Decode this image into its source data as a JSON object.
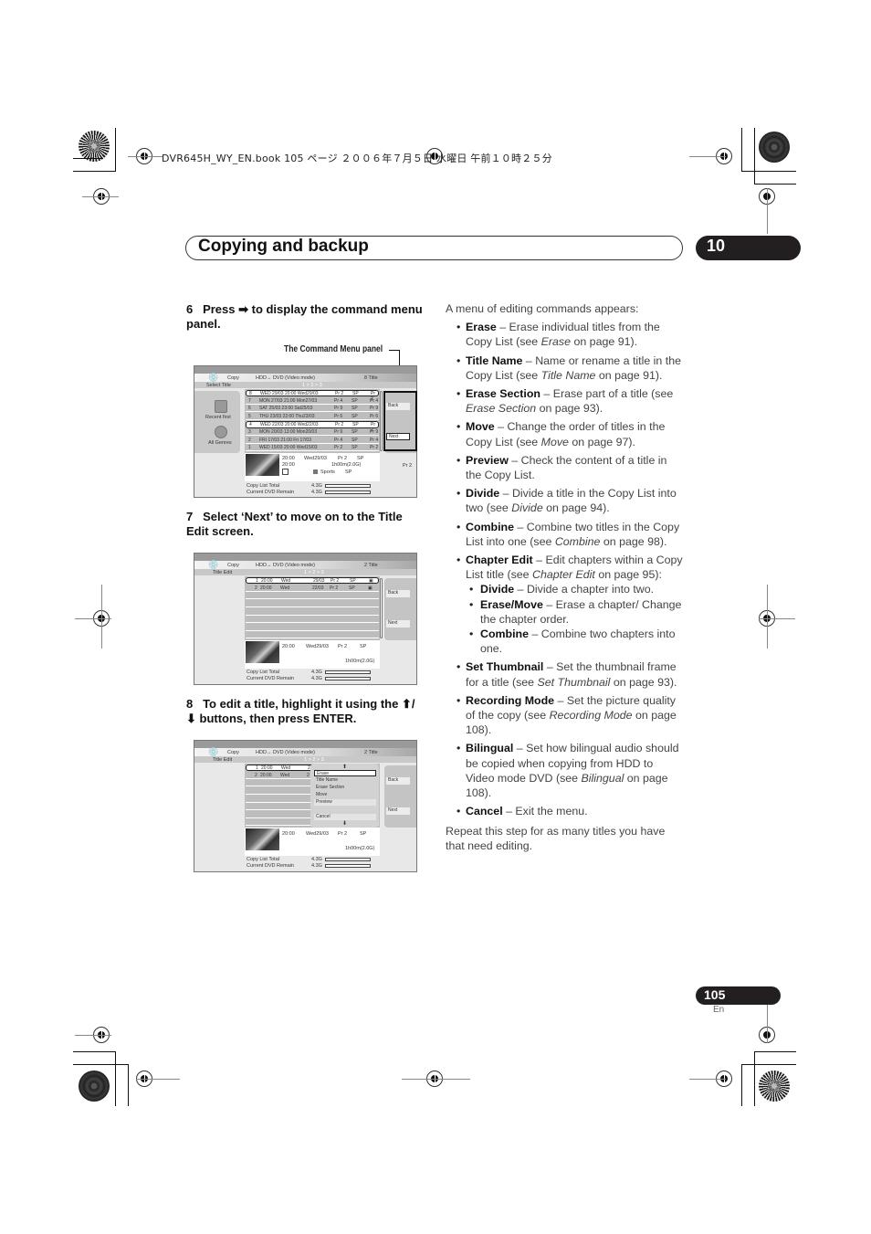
{
  "print_header": "DVR645H_WY_EN.book  105 ページ  ２００６年７月５日  水曜日  午前１０時２５分",
  "chapter": {
    "title": "Copying and backup",
    "number": "10"
  },
  "steps": [
    {
      "num": "6",
      "text": "Press ➡ to display the command menu panel."
    },
    {
      "num": "7",
      "text": "Select ‘Next’ to move on to the Title Edit screen."
    },
    {
      "num": "8",
      "text": "To edit a title, highlight it using the ⬆/⬇ buttons, then press ENTER."
    }
  ],
  "callout": "The Command Menu panel",
  "screen1": {
    "mode": "Copy",
    "route": "HDD→ DVD (Video mode)",
    "count": "8  Title",
    "section": "Select Title",
    "pager": "1 > 2 > 3",
    "left_options": [
      "Recent first",
      "All Genres"
    ],
    "rows": [
      [
        "8",
        "WED 29/03 20:00 Wed29/03",
        "Pr 2",
        "SP",
        "Pr 2"
      ],
      [
        "7",
        "MON 27/03 21:00 Mon27/03",
        "Pr 4",
        "SP",
        "Pr 4"
      ],
      [
        "6",
        "SAT 25/03 23:00 Sat25/03",
        "Pr 9",
        "SP",
        "Pr 9"
      ],
      [
        "5",
        "THU 23/03 22:00 Thu23/03",
        "Pr 6",
        "SP",
        "Pr 6"
      ],
      [
        "4",
        "WED 22/03 20:00 Wed22/03",
        "Pr 2",
        "SP",
        "Pr 2"
      ],
      [
        "3",
        "MON 20/03 13:00 Mon20/03",
        "Pr 9",
        "SP",
        "Pr 9"
      ],
      [
        "2",
        "FRI 17/03 21:00 Fri 17/03",
        "Pr 4",
        "SP",
        "Pr 4"
      ],
      [
        "1",
        "WED 15/03 20:00 Wed15/03",
        "Pr 2",
        "SP",
        "Pr 2"
      ]
    ],
    "buttons": [
      "Back",
      "Next"
    ],
    "preview": {
      "time1": "20:00",
      "time2": "20:00",
      "date": "Wed29/03",
      "ch": "Pr 2",
      "mode": "SP",
      "duration": "1h00m(2.0G)",
      "genre": "Sports",
      "genre_mode": "SP",
      "side": "Pr 2"
    },
    "totals": [
      {
        "label": "Copy List Total",
        "value": "4.3G"
      },
      {
        "label": "Current DVD Remain",
        "value": "4.3G"
      }
    ]
  },
  "screen2": {
    "mode": "Copy",
    "route": "HDD→ DVD (Video mode)",
    "count": "2  Title",
    "section": "Title Edit",
    "pager": "1 > 2 > 3",
    "rows": [
      [
        "1",
        "20:00",
        "Wed",
        "29/03",
        "Pr 2",
        "SP"
      ],
      [
        "2",
        "20:00",
        "Wed",
        "22/03",
        "Pr 2",
        "SP"
      ]
    ],
    "buttons": [
      "Back",
      "Next"
    ],
    "preview": {
      "time": "20:00",
      "date": "Wed29/03",
      "ch": "Pr 2",
      "mode": "SP",
      "duration": "1h00m(2.0G)"
    },
    "totals": [
      {
        "label": "Copy List Total",
        "value": "4.3G"
      },
      {
        "label": "Current DVD Remain",
        "value": "4.3G"
      }
    ]
  },
  "screen3": {
    "popup_items": [
      "Erase",
      "Title Name",
      "Erase Section",
      "Move",
      "Preview",
      "Cancel"
    ]
  },
  "right_column": {
    "intro": "A menu of editing commands appears:",
    "items": [
      {
        "term": "Erase",
        "desc": " – Erase individual titles from the Copy List (see ",
        "ref": "Erase",
        "tail": " on page 91)."
      },
      {
        "term": "Title Name",
        "desc": " – Name or rename a title in the Copy List (see ",
        "ref": "Title Name",
        "tail": " on page 91)."
      },
      {
        "term": "Erase Section",
        "desc": " – Erase part of a title (see ",
        "ref": "Erase Section",
        "tail": " on page 93)."
      },
      {
        "term": "Move",
        "desc": " – Change the order of titles in the Copy List (see ",
        "ref": "Move",
        "tail": " on page 97)."
      },
      {
        "term": "Preview",
        "desc": " – Check the content of a title in the Copy List.",
        "ref": "",
        "tail": ""
      },
      {
        "term": "Divide",
        "desc": " – Divide a title in the Copy List into two (see ",
        "ref": "Divide",
        "tail": " on page 94)."
      },
      {
        "term": "Combine",
        "desc": " – Combine two titles in the Copy List into one (see ",
        "ref": "Combine",
        "tail": " on page 98)."
      },
      {
        "term": "Chapter Edit",
        "desc": " – Edit chapters within a Copy List title (see ",
        "ref": "Chapter Edit",
        "tail": " on page 95):"
      }
    ],
    "chapter_sub": [
      {
        "term": "Divide",
        "desc": " – Divide a chapter into two."
      },
      {
        "term": "Erase/Move",
        "desc": " – Erase a chapter/ Change the chapter order."
      },
      {
        "term": "Combine",
        "desc": " – Combine two chapters into one."
      }
    ],
    "items2": [
      {
        "term": "Set Thumbnail",
        "desc": " – Set the thumbnail frame for a title (see ",
        "ref": "Set Thumbnail",
        "tail": " on page 93)."
      },
      {
        "term": "Recording Mode",
        "desc": " – Set the picture quality of the copy (see ",
        "ref": "Recording Mode",
        "tail": " on page 108)."
      },
      {
        "term": "Bilingual",
        "desc": " – Set how bilingual audio should be copied when copying from HDD to Video mode DVD (see ",
        "ref": "Bilingual",
        "tail": " on page 108)."
      },
      {
        "term": "Cancel",
        "desc": " – Exit the menu.",
        "ref": "",
        "tail": ""
      }
    ],
    "outro": "Repeat this step for as many titles you have that need editing."
  },
  "footer": {
    "page": "105",
    "lang": "En"
  }
}
